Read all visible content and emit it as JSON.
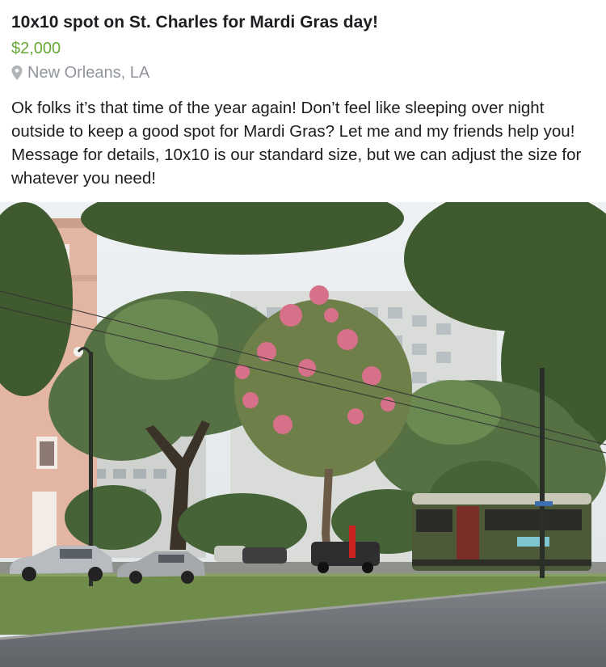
{
  "listing": {
    "title": "10x10 spot on St. Charles for Mardi Gras day!",
    "price": "$2,000",
    "location": "New Orleans, LA",
    "location_icon": "map-pin-icon",
    "description": "Ok folks it’s that time of the year again! Don’t feel like sleeping over night outside to keep a good spot for Mardi Gras? Let me and my friends help you! Message for details, 10x10 is our standard size, but we can adjust the size for whatever you need!",
    "colors": {
      "price": "#67a836",
      "location": "#90949c",
      "text": "#1c1e21"
    }
  }
}
